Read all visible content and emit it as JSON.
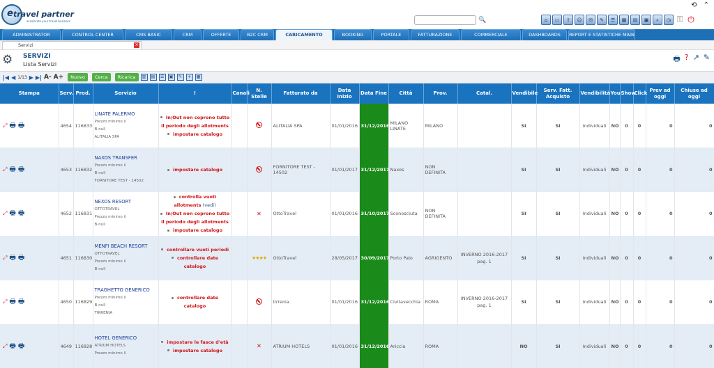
{
  "brand": {
    "logo_text": "travel partner",
    "logo_e": "e",
    "tagline": "accelerate your travel business"
  },
  "search": {
    "placeholder": ""
  },
  "topright": {
    "sync": "⟲",
    "collapse": "⌃"
  },
  "icons": [
    "home-icon",
    "window-icon",
    "export-icon",
    "user-icon",
    "mail-icon",
    "edit-icon",
    "list-icon",
    "calendar-icon",
    "form-icon",
    "doc-icon",
    "search-icon",
    "clock-icon",
    "key-icon",
    "power-icon"
  ],
  "tabs": [
    {
      "label": "ADMINISTRATOR",
      "w": 84
    },
    {
      "label": "CONTROL CENTER",
      "w": 88
    },
    {
      "label": "CMS BASIC",
      "w": 68
    },
    {
      "label": "CRM",
      "w": 40
    },
    {
      "label": "OFFERTE",
      "w": 52
    },
    {
      "label": "B2C CRM",
      "w": 48
    },
    {
      "label": "CARICAMENTO",
      "w": 82,
      "active": true
    },
    {
      "label": "BOOKING",
      "w": 54
    },
    {
      "label": "PORTALE",
      "w": 52
    },
    {
      "label": "FATTURAZIONE",
      "w": 70
    },
    {
      "label": "COMMERCIALE",
      "w": 86
    },
    {
      "label": "DASHBOARDS",
      "w": 64
    },
    {
      "label": "REPORT E STATISTICHE MAIN",
      "w": 96
    }
  ],
  "subtab": {
    "label": "Servizi"
  },
  "page": {
    "title": "SERVIZI",
    "subtitle": "Lista Servizi"
  },
  "toolbar": {
    "page": "1/13",
    "btn_new": "Nuovo",
    "btn_search": "Cerca",
    "btn_reload": "Ricarica"
  },
  "columns": [
    "Stampa",
    "Serv.",
    "Prod.",
    "Servizio",
    "!",
    "Canali",
    "N. Stelle",
    "Fatturato da",
    "Data Inizio",
    "Data Fine",
    "Città",
    "Prov.",
    "Catal.",
    "Vendibile",
    "Serv. Fatt. Acquisto",
    "Vendibilità",
    "You",
    "Show",
    "Click",
    "Prev ad oggi",
    "Chiuse ad oggi"
  ],
  "rows": [
    {
      "serv": "4654",
      "prod": "116833",
      "name": "LINATE PALERMO",
      "details": [
        "Prezzo minimo il",
        "B-null",
        "ALITALIA SPA"
      ],
      "warnings": [
        {
          "t": "In/Out non coprono tutto il periodo degli allotments"
        },
        {
          "t": "impostare catalogo"
        }
      ],
      "stelle": "ban",
      "fatturato": "ALITALIA SPA",
      "inizio": "01/01/2016",
      "fine": "31/12/2016",
      "citta": "MILANO LINATE",
      "prov": "MILANO",
      "catal": "",
      "vendibile": "SI",
      "servfatt": "SI",
      "vendibilita": "Individuali",
      "you": "NO",
      "show": "0",
      "click": "0",
      "prev": "0",
      "chiuse": "0"
    },
    {
      "serv": "4653",
      "prod": "116832",
      "name": "NAXOS TRANSFER",
      "details": [
        "Prezzo minimo il",
        "B-null",
        "FORNITORE TEST - 14502"
      ],
      "warnings": [
        {
          "t": "impostare catalogo"
        }
      ],
      "stelle": "ban",
      "fatturato": "FORNITORE TEST - 14502",
      "inizio": "01/01/2017",
      "fine": "31/12/2017",
      "citta": "Naxos",
      "prov": "NON DEFINITA",
      "catal": "",
      "vendibile": "SI",
      "servfatt": "SI",
      "vendibilita": "Individuali",
      "you": "NO",
      "show": "0",
      "click": "0",
      "prev": "0",
      "chiuse": "0"
    },
    {
      "serv": "4652",
      "prod": "116831",
      "name": "NEXOS RESORT",
      "details": [
        "OTTOTRAVEL",
        "Prezzo minimo il",
        "B-null"
      ],
      "warnings": [
        {
          "t": "controlla vuoti allotments",
          "vedi": "(vedi)"
        },
        {
          "t": "In/Out non coprono tutto il periodo degli allotments"
        },
        {
          "t": "impostare catalogo"
        }
      ],
      "stelle": "x",
      "fatturato": "OttoTravel",
      "inizio": "01/01/2016",
      "fine": "31/10/2017",
      "citta": "Sconosciuta",
      "prov": "NON DEFINITA",
      "catal": "",
      "vendibile": "SI",
      "servfatt": "SI",
      "vendibilita": "Individuali",
      "you": "NO",
      "show": "0",
      "click": "0",
      "prev": "0",
      "chiuse": "0"
    },
    {
      "serv": "4651",
      "prod": "116830",
      "name": "MENFI BEACH RESORT",
      "details": [
        "OTTOTRAVEL",
        "Prezzo minimo il",
        "B-null"
      ],
      "warnings": [
        {
          "t": "controllare vuoti periodi"
        },
        {
          "t": "controllare date catalogo"
        }
      ],
      "stelle": "★★★★",
      "fatturato": "OttoTravel",
      "inizio": "28/05/2017",
      "fine": "30/09/2017",
      "citta": "Porto Palo",
      "prov": "AGRIGENTO",
      "catal": "INVERNO 2016-2017 pag. 1",
      "vendibile": "SI",
      "servfatt": "SI",
      "vendibilita": "Individuali",
      "you": "NO",
      "show": "0",
      "click": "0",
      "prev": "0",
      "chiuse": "0"
    },
    {
      "serv": "4650",
      "prod": "116829",
      "name": "TRAGHETTO GENERICO",
      "details": [
        "Prezzo minimo il",
        "B-null",
        "TIRRENIA"
      ],
      "warnings": [
        {
          "t": "controllare date catalogo"
        }
      ],
      "stelle": "ban",
      "fatturato": "tirrenia",
      "inizio": "01/01/2016",
      "fine": "31/12/2016",
      "citta": "Civitavecchia",
      "prov": "ROMA",
      "catal": "INVERNO 2016-2017 pag. 1",
      "vendibile": "SI",
      "servfatt": "SI",
      "vendibilita": "Individuali",
      "you": "NO",
      "show": "0",
      "click": "0",
      "prev": "0",
      "chiuse": "0"
    },
    {
      "serv": "4649",
      "prod": "116828",
      "name": "HOTEL GENERICO",
      "details": [
        "ATRIUM HOTELS",
        "Prezzo minimo il"
      ],
      "warnings": [
        {
          "t": "impostare le fasce d'età"
        },
        {
          "t": "impostare catalogo"
        }
      ],
      "stelle": "x",
      "fatturato": "ATRIUM HOTELS",
      "inizio": "01/01/2016",
      "fine": "31/12/2016",
      "citta": "Ariccia",
      "prov": "ROMA",
      "catal": "",
      "vendibile": "NO",
      "servfatt": "SI",
      "vendibilita": "Individuali",
      "you": "NO",
      "show": "0",
      "click": "0",
      "prev": "0",
      "chiuse": "0"
    }
  ]
}
